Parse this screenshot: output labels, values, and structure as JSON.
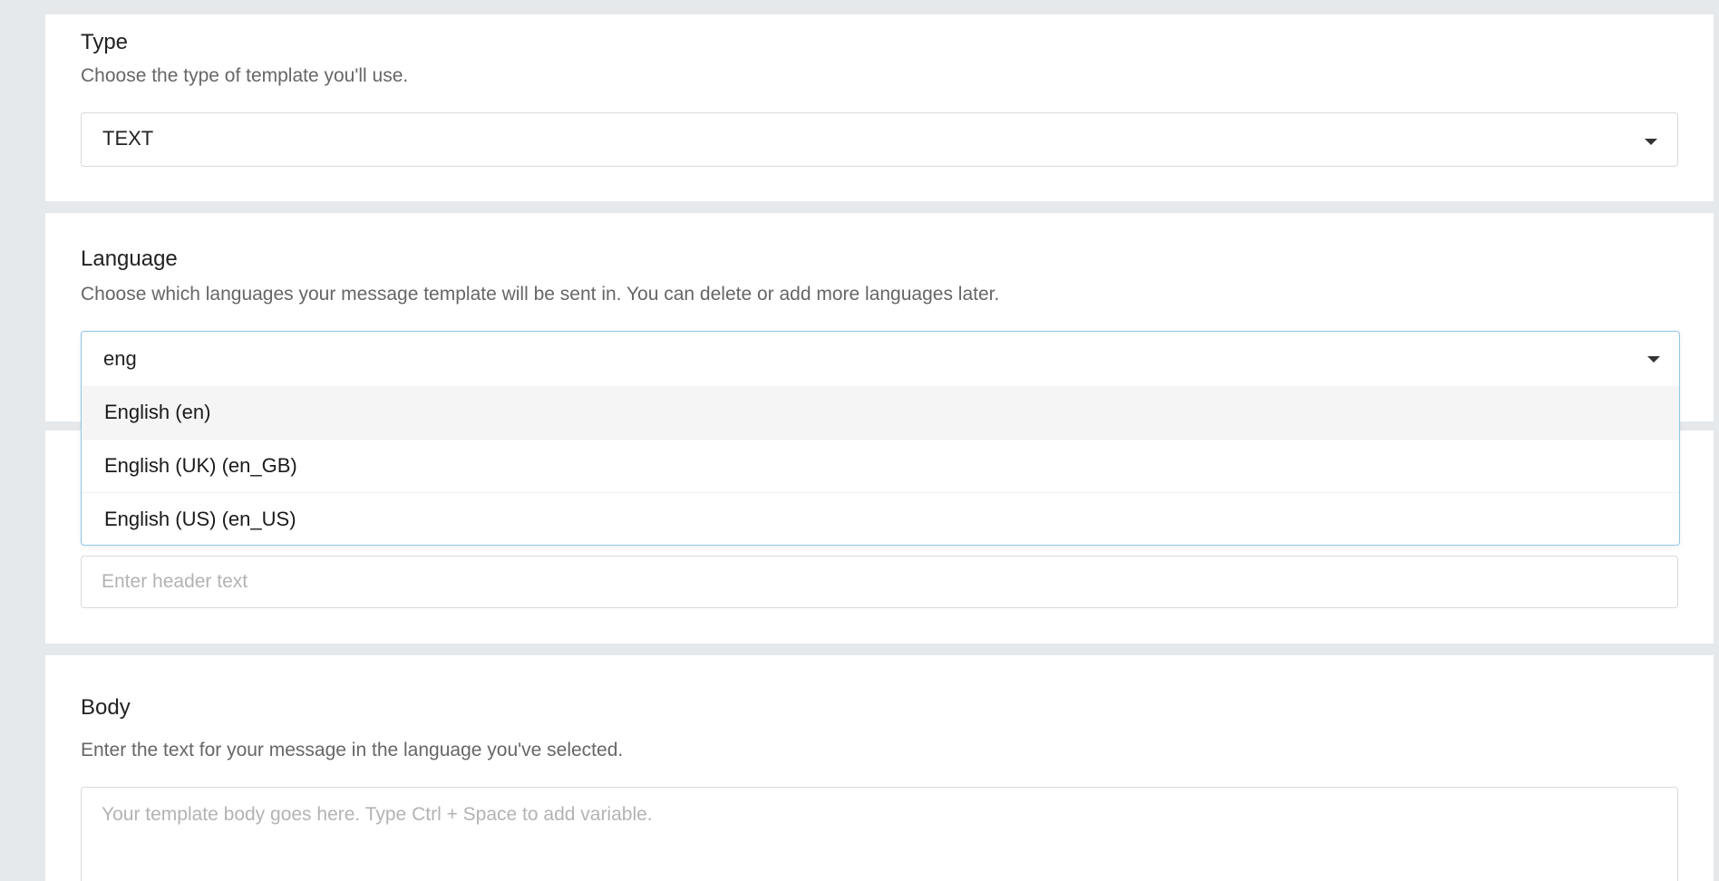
{
  "type_section": {
    "title": "Type",
    "description": "Choose the type of template you'll use.",
    "selected": "TEXT"
  },
  "language_section": {
    "title": "Language",
    "description": "Choose which languages your message template will be sent in. You can delete or add more languages later.",
    "search_value": "eng",
    "options": [
      {
        "label": "English (en)",
        "highlighted": true
      },
      {
        "label": "English (UK) (en_GB)",
        "highlighted": false
      },
      {
        "label": "English (US) (en_US)",
        "highlighted": false
      }
    ]
  },
  "header_section": {
    "placeholder": "Enter header text"
  },
  "body_section": {
    "title": "Body",
    "description": "Enter the text for your message in the language you've selected.",
    "placeholder": "Your template body goes here. Type Ctrl + Space to add variable."
  },
  "icons": {
    "dropdown": "caret-down-icon"
  }
}
